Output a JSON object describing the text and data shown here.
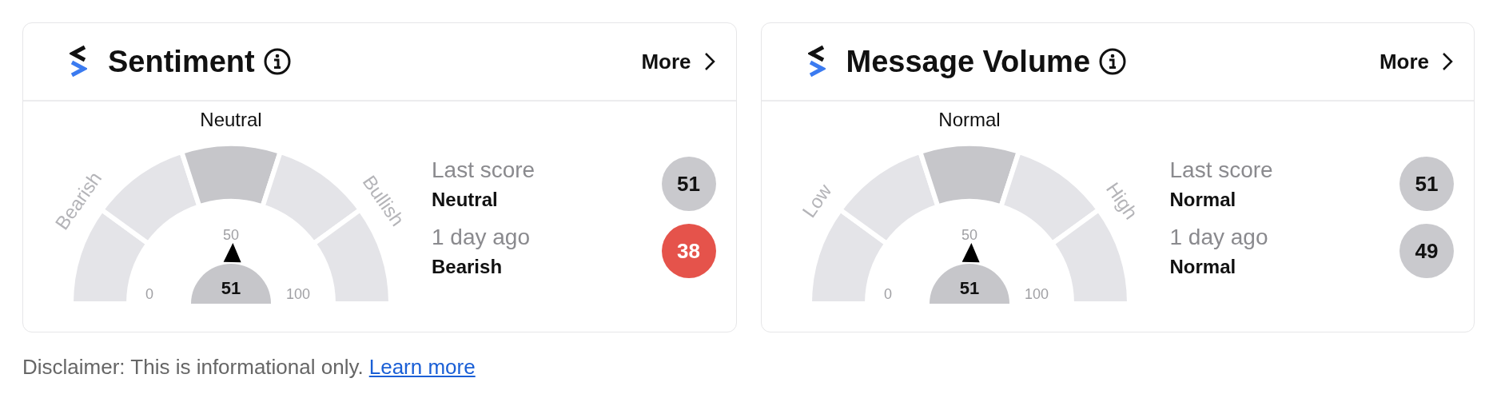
{
  "widgets": [
    {
      "title": "Sentiment",
      "more": "More",
      "gauge": {
        "top_label": "Neutral",
        "left_label": "Bearish",
        "right_label": "Bullish",
        "tick_min": "0",
        "tick_mid": "50",
        "tick_max": "100",
        "value": "51",
        "segments": [
          {
            "selected": false
          },
          {
            "selected": false
          },
          {
            "selected": true
          },
          {
            "selected": false
          },
          {
            "selected": false
          }
        ]
      },
      "scores": [
        {
          "label": "Last score",
          "status": "Neutral",
          "value": "51",
          "color": "#c9c9cd"
        },
        {
          "label": "1 day ago",
          "status": "Bearish",
          "value": "38",
          "color": "#e5534b"
        }
      ]
    },
    {
      "title": "Message Volume",
      "more": "More",
      "gauge": {
        "top_label": "Normal",
        "left_label": "Low",
        "right_label": "High",
        "tick_min": "0",
        "tick_mid": "50",
        "tick_max": "100",
        "value": "51",
        "segments": [
          {
            "selected": false
          },
          {
            "selected": false
          },
          {
            "selected": true
          },
          {
            "selected": false
          },
          {
            "selected": false
          }
        ]
      },
      "scores": [
        {
          "label": "Last score",
          "status": "Normal",
          "value": "51",
          "color": "#c9c9cd"
        },
        {
          "label": "1 day ago",
          "status": "Normal",
          "value": "49",
          "color": "#c9c9cd"
        }
      ]
    }
  ],
  "disclaimer": {
    "text": "Disclaimer: This is informational only.",
    "link": "Learn more"
  }
}
